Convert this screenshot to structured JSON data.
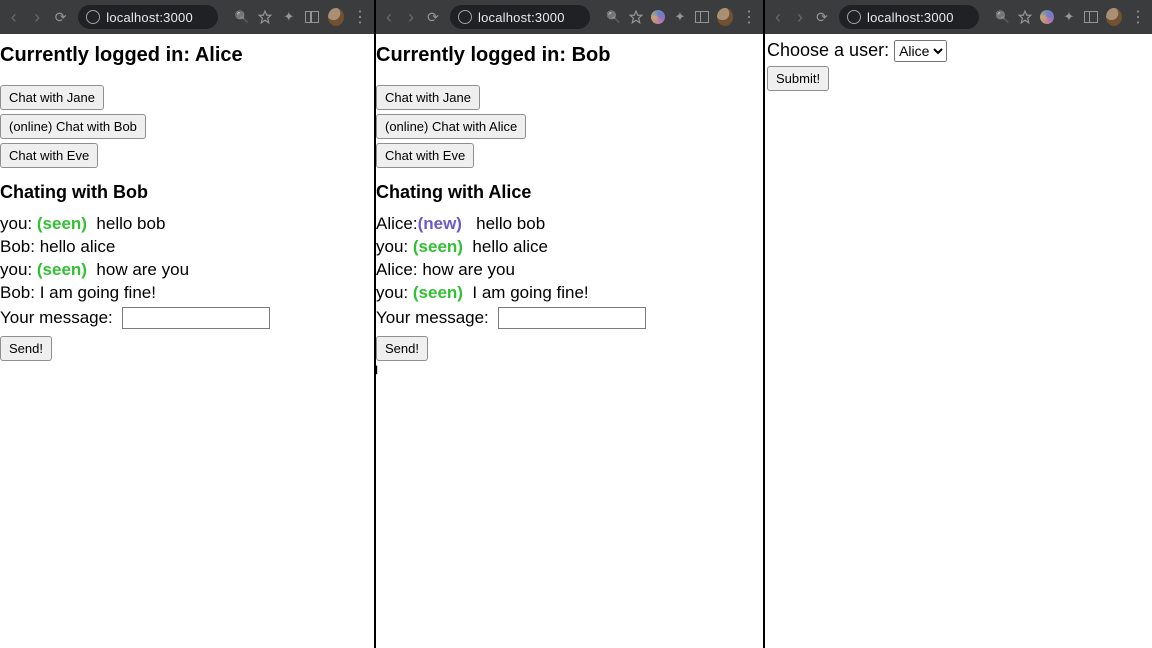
{
  "toolbar": {
    "url": "localhost:3000"
  },
  "windows": [
    {
      "title_prefix": "Currently logged in: ",
      "user": "Alice",
      "contacts": [
        {
          "label": "Chat with Jane"
        },
        {
          "label": "(online) Chat with Bob"
        },
        {
          "label": "Chat with Eve"
        }
      ],
      "chat_with_prefix": "Chating with ",
      "chat_with": "Bob",
      "messages": [
        {
          "from": "you:",
          "status": "(seen)",
          "status_class": "seen",
          "text": "hello bob"
        },
        {
          "from": "Bob:",
          "status": "",
          "status_class": "",
          "text": "hello alice"
        },
        {
          "from": "you:",
          "status": "(seen)",
          "status_class": "seen",
          "text": "how are you"
        },
        {
          "from": "Bob:",
          "status": "",
          "status_class": "",
          "text": "I am going fine!"
        }
      ],
      "compose_label": "Your message:",
      "compose_value": "",
      "send_label": "Send!"
    },
    {
      "title_prefix": "Currently logged in: ",
      "user": "Bob",
      "contacts": [
        {
          "label": "Chat with Jane"
        },
        {
          "label": "(online) Chat with Alice"
        },
        {
          "label": "Chat with Eve"
        }
      ],
      "chat_with_prefix": "Chating with ",
      "chat_with": "Alice",
      "messages": [
        {
          "from": "Alice:",
          "status": "(new)",
          "status_class": "new",
          "text": "hello bob"
        },
        {
          "from": "you:",
          "status": "(seen)",
          "status_class": "seen",
          "text": "hello alice"
        },
        {
          "from": "Alice:",
          "status": "",
          "status_class": "",
          "text": "how are you"
        },
        {
          "from": "you:",
          "status": "(seen)",
          "status_class": "seen",
          "text": "I am going fine!"
        }
      ],
      "compose_label": "Your message:",
      "compose_value": "",
      "send_label": "Send!"
    },
    {
      "chooser_label": "Choose a user:",
      "selected": "Alice",
      "submit_label": "Submit!"
    }
  ]
}
